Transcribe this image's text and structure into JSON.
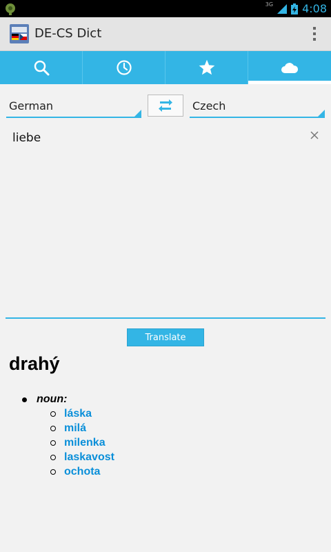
{
  "status_bar": {
    "time": "4:08",
    "network": "3G",
    "colors": {
      "accent": "#33b5e5"
    }
  },
  "action_bar": {
    "title": "DE-CS Dict",
    "app_icon": "flag-dictionary-icon",
    "overflow_icon": "overflow-menu-icon"
  },
  "tabs": [
    {
      "icon": "search-icon",
      "active": false
    },
    {
      "icon": "history-clock-icon",
      "active": false
    },
    {
      "icon": "star-icon",
      "active": false
    },
    {
      "icon": "cloud-icon",
      "active": true
    }
  ],
  "languages": {
    "source": "German",
    "target": "Czech",
    "swap_icon": "swap-arrows-icon"
  },
  "input": {
    "value": "liebe",
    "clear_icon": "close-icon"
  },
  "translate_button": "Translate",
  "result": {
    "headword": "drahý",
    "part_of_speech": "noun:",
    "translations": [
      "láska",
      "milá",
      "milenka",
      "laskavost",
      "ochota"
    ]
  },
  "colors": {
    "accent": "#33b5e5",
    "link": "#0a8fd9",
    "background": "#f2f2f2"
  }
}
